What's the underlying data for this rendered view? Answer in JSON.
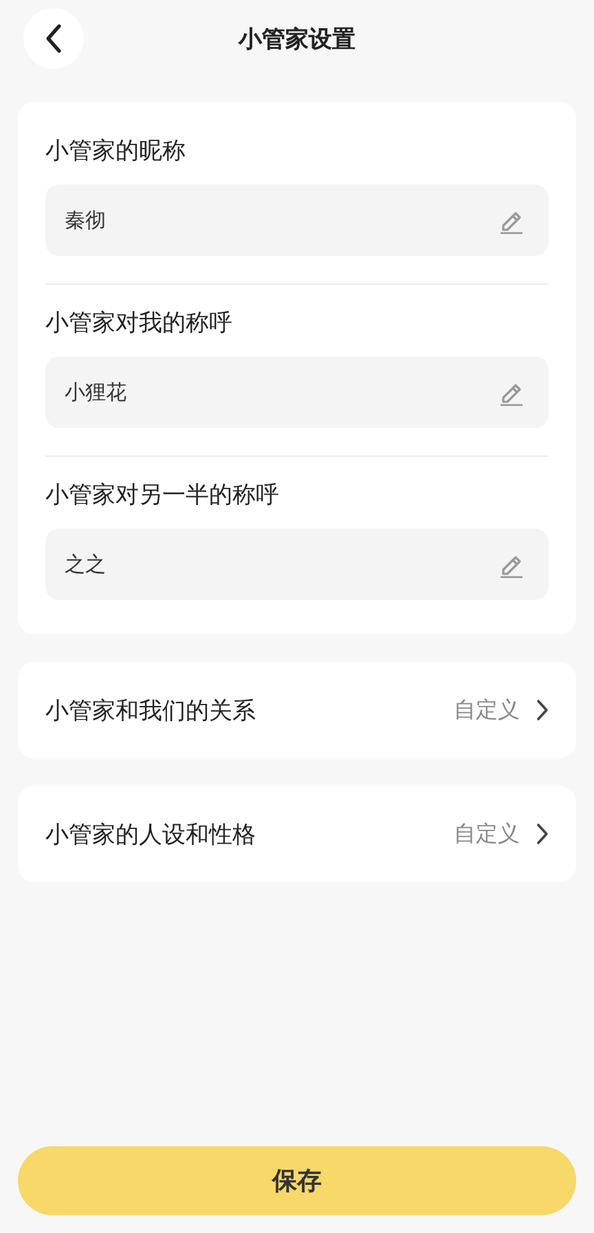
{
  "header": {
    "title": "小管家设置"
  },
  "fields": [
    {
      "label": "小管家的昵称",
      "value": "秦彻"
    },
    {
      "label": "小管家对我的称呼",
      "value": "小狸花"
    },
    {
      "label": "小管家对另一半的称呼",
      "value": "之之"
    }
  ],
  "options": [
    {
      "label": "小管家和我们的关系",
      "value": "自定义"
    },
    {
      "label": "小管家的人设和性格",
      "value": "自定义"
    }
  ],
  "save_button": "保存"
}
